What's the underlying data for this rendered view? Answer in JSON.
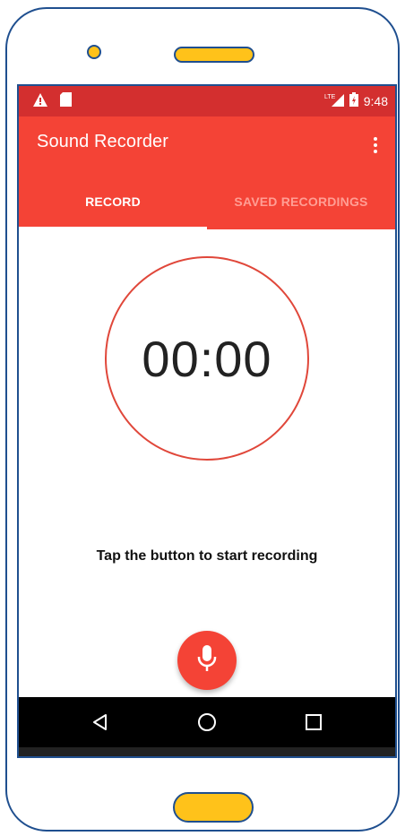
{
  "status_bar": {
    "time": "9:48",
    "network": "LTE",
    "icons": [
      "warning-icon",
      "sd-card-icon",
      "signal-icon",
      "battery-icon"
    ]
  },
  "toolbar": {
    "title": "Sound Recorder",
    "overflow_icon": "more-vert-icon"
  },
  "tabs": [
    {
      "label": "RECORD",
      "active": true
    },
    {
      "label": "SAVED RECORDINGS",
      "active": false
    }
  ],
  "recorder": {
    "timer": "00:00",
    "hint": "Tap the button to start recording",
    "mic_icon": "microphone-icon"
  },
  "nav": {
    "icons": [
      "back-icon",
      "home-icon",
      "recents-icon"
    ]
  },
  "colors": {
    "primary": "#f44336",
    "primary_dark": "#d32f2f",
    "frame_border": "#1f4f8f",
    "frame_accent": "#ffc21a"
  }
}
